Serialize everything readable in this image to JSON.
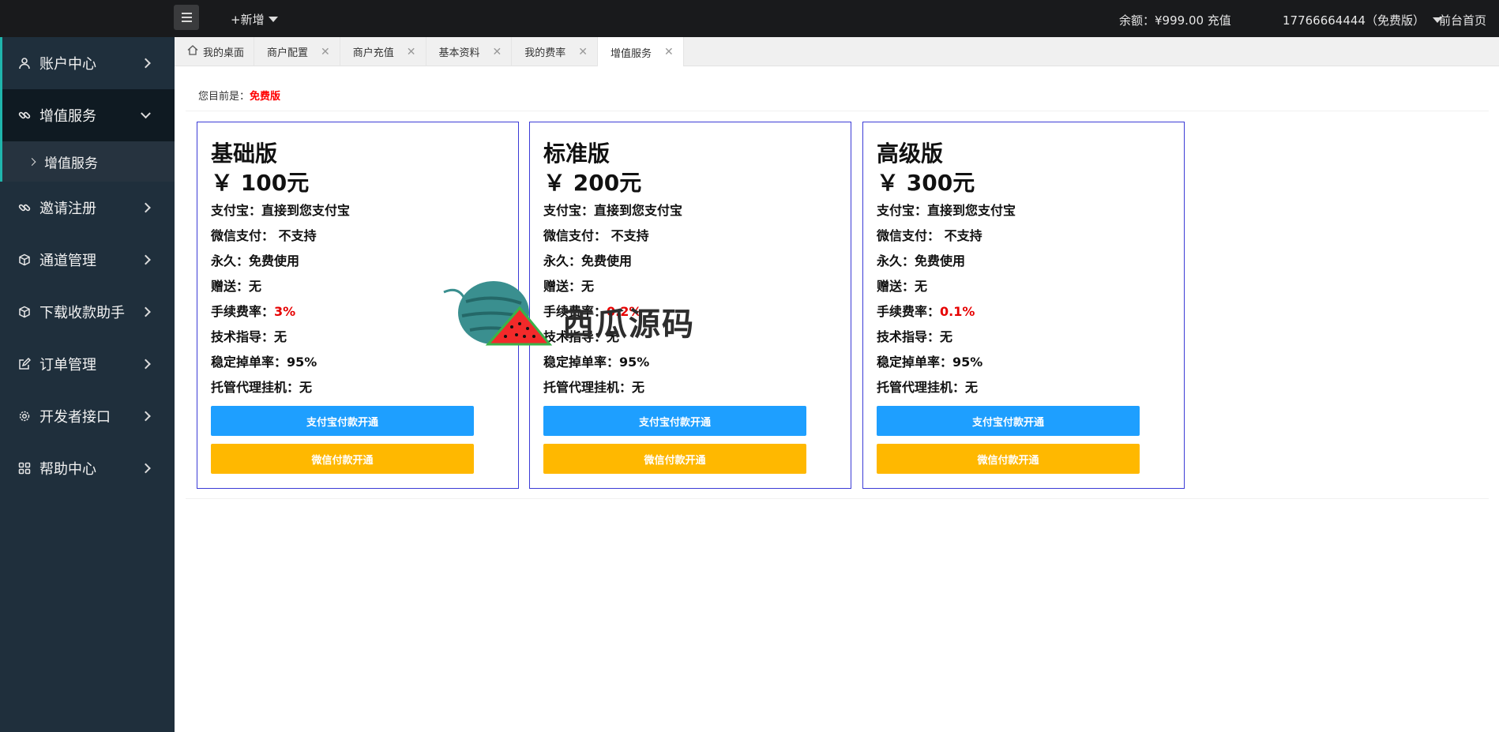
{
  "topbar": {
    "add_new": "+新增",
    "balance": "余额：¥999.00 充值",
    "user": "17766664444（免费版）",
    "front_home": "前台首页"
  },
  "sidebar": {
    "items": [
      {
        "label": "账户中心",
        "icon": "user-icon"
      },
      {
        "label": "增值服务",
        "icon": "link-icon",
        "open": true
      },
      {
        "label": "邀请注册",
        "icon": "link-icon"
      },
      {
        "label": "通道管理",
        "icon": "cube-icon"
      },
      {
        "label": "下载收款助手",
        "icon": "cube-icon"
      },
      {
        "label": "订单管理",
        "icon": "edit-icon"
      },
      {
        "label": "开发者接口",
        "icon": "gear-icon"
      },
      {
        "label": "帮助中心",
        "icon": "grid-icon"
      }
    ],
    "sub_item": "增值服务"
  },
  "tabs": [
    {
      "label": "我的桌面",
      "closable": false
    },
    {
      "label": "商户配置",
      "closable": true
    },
    {
      "label": "商户充值",
      "closable": true
    },
    {
      "label": "基本资料",
      "closable": true
    },
    {
      "label": "我的费率",
      "closable": true
    },
    {
      "label": "增值服务",
      "closable": true,
      "active": true
    }
  ],
  "content": {
    "status_prefix": "您目前是：",
    "status_plan": "免费版"
  },
  "plans": [
    {
      "name": "基础版",
      "price": "￥ 100元",
      "alipay": "支付宝：直接到您支付宝",
      "wechat": "微信支付： 不支持",
      "duration": "永久：免费使用",
      "gift": "赠送：无",
      "fee_label": "手续费率：",
      "fee_value": "3%",
      "guidance": "技术指导：无",
      "stability": "稳定掉单率：95%",
      "hosting": "托管代理挂机：无",
      "btn_alipay": "支付宝付款开通",
      "btn_wechat": "微信付款开通"
    },
    {
      "name": "标准版",
      "price": "￥ 200元",
      "alipay": "支付宝：直接到您支付宝",
      "wechat": "微信支付： 不支持",
      "duration": "永久：免费使用",
      "gift": "赠送：无",
      "fee_label": "手续费率：",
      "fee_value": "0.2%",
      "guidance": "技术指导：无",
      "stability": "稳定掉单率：95%",
      "hosting": "托管代理挂机：无",
      "btn_alipay": "支付宝付款开通",
      "btn_wechat": "微信付款开通"
    },
    {
      "name": "高级版",
      "price": "￥ 300元",
      "alipay": "支付宝：直接到您支付宝",
      "wechat": "微信支付： 不支持",
      "duration": "永久：免费使用",
      "gift": "赠送：无",
      "fee_label": "手续费率：",
      "fee_value": "0.1%",
      "guidance": "技术指导：无",
      "stability": "稳定掉单率：95%",
      "hosting": "托管代理挂机：无",
      "btn_alipay": "支付宝付款开通",
      "btn_wechat": "微信付款开通"
    }
  ],
  "watermark": {
    "text": "西瓜源码"
  },
  "colors": {
    "topbar": "#191a1c",
    "sidebar": "#1f2f3c",
    "accent": "#1fb5ac",
    "card_border": "#3b3bd6",
    "alipay_button": "#1e9fff",
    "wechat_button": "#ffb800",
    "highlight": "#e60000"
  }
}
